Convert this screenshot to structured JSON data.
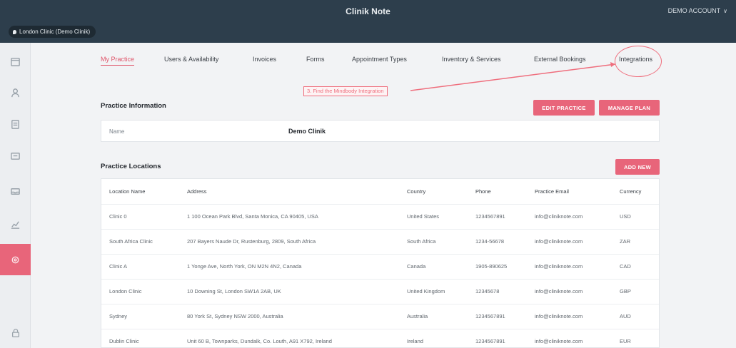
{
  "header": {
    "title": "Clinik Note",
    "account_label": "DEMO ACCOUNT",
    "account_chevron": "chevron-down-icon",
    "clinic_selector": "London Clinic (Demo Clinik)"
  },
  "sidebar": {
    "items": [
      {
        "icon": "calendar-icon",
        "active": false
      },
      {
        "icon": "user-icon",
        "active": false
      },
      {
        "icon": "document-icon",
        "active": false
      },
      {
        "icon": "folder-icon",
        "active": false
      },
      {
        "icon": "inbox-icon",
        "active": false
      },
      {
        "icon": "chart-icon",
        "active": false
      },
      {
        "icon": "settings-icon",
        "active": true
      }
    ],
    "bottom_icon": "lock-icon"
  },
  "tabs": [
    {
      "label": "My Practice",
      "active": true
    },
    {
      "label": "Users & Availability",
      "active": false
    },
    {
      "label": "Invoices",
      "active": false
    },
    {
      "label": "Forms",
      "active": false
    },
    {
      "label": "Appointment Types",
      "active": false
    },
    {
      "label": "Inventory & Services",
      "active": false
    },
    {
      "label": "External Bookings",
      "active": false
    },
    {
      "label": "Integrations",
      "active": false
    }
  ],
  "annotation": {
    "callout_text": "3. Find the Mindbody Integration"
  },
  "practice_info": {
    "title": "Practice Information",
    "edit_button": "EDIT PRACTICE",
    "manage_button": "MANAGE PLAN",
    "name_label": "Name",
    "name_value": "Demo Clinik"
  },
  "locations": {
    "title": "Practice Locations",
    "add_button": "ADD NEW",
    "columns": [
      "Location Name",
      "Address",
      "Country",
      "Phone",
      "Practice Email",
      "Currency"
    ],
    "rows": [
      [
        "Clinic 0",
        "1 100 Ocean Park Blvd, Santa Monica, CA 90405, USA",
        "United States",
        "1234567891",
        "info@cliniknote.com",
        "USD"
      ],
      [
        "South Africa Clinic",
        "207 Bayers Naude Dr, Rustenburg, 2809, South Africa",
        "South Africa",
        "1234-56678",
        "info@cliniknote.com",
        "ZAR"
      ],
      [
        "Clinic A",
        "1 Yonge Ave, North York, ON M2N 4N2, Canada",
        "Canada",
        "1905-890625",
        "info@cliniknote.com",
        "CAD"
      ],
      [
        "London Clinic",
        "10 Downing St, London SW1A 2AB, UK",
        "United Kingdom",
        "12345678",
        "info@cliniknote.com",
        "GBP"
      ],
      [
        "Sydney",
        "80 York St, Sydney NSW 2000, Australia",
        "Australia",
        "1234567891",
        "info@cliniknote.com",
        "AUD"
      ],
      [
        "Dublin Clinic",
        "Unit 60 B, Townparks, Dundalk, Co. Louth, A91 X792, Ireland",
        "Ireland",
        "1234567891",
        "info@cliniknote.com",
        "EUR"
      ]
    ]
  }
}
